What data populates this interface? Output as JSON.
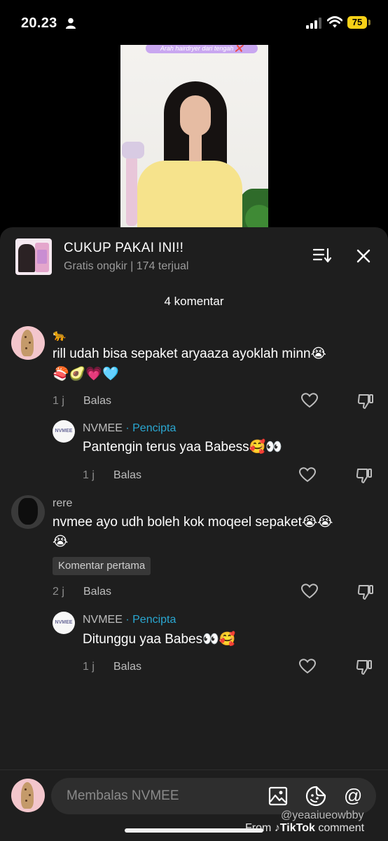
{
  "status_bar": {
    "time": "20.23",
    "battery": "75"
  },
  "video": {
    "caption": "Arah hairdryer dari tengah ❌"
  },
  "product": {
    "title": "CUKUP PAKAI INI!!",
    "subtitle": "Gratis ongkir | 174 terjual"
  },
  "comments_header": {
    "count_label": "4 komentar"
  },
  "comments": [
    {
      "username": "🐆",
      "text_line1": "rill udah bisa sepaket aryaaza ayoklah minn😭",
      "text_line2": "🍣🥑💗🩵",
      "time": "1 j",
      "reply_label": "Balas",
      "reply": {
        "username": "NVMEE",
        "creator_label": "· Pencipta",
        "avatar_text": "NVMEE",
        "text": "Pantengin terus yaa Babess🥰👀",
        "time": "1 j",
        "reply_label": "Balas"
      }
    },
    {
      "username": "rere",
      "text_line1": "nvmee ayo udh boleh kok moqeel sepaket😭😭",
      "text_line2": "😭",
      "badge": "Komentar pertama",
      "time": "2 j",
      "reply_label": "Balas",
      "reply": {
        "username": "NVMEE",
        "creator_label": "· Pencipta",
        "avatar_text": "NVMEE",
        "text": "Ditunggu yaa Babes👀🥰",
        "time": "1 j",
        "reply_label": "Balas"
      }
    }
  ],
  "input": {
    "placeholder": "Membalas NVMEE"
  },
  "watermark": {
    "handle": "@yeaaiueowbby",
    "from": "From",
    "brand": "TikTok",
    "suffix": "comment"
  },
  "colors": {
    "panel_bg": "#1e1e1e",
    "creator_accent": "#2aa7d1",
    "battery": "#f7d117"
  }
}
